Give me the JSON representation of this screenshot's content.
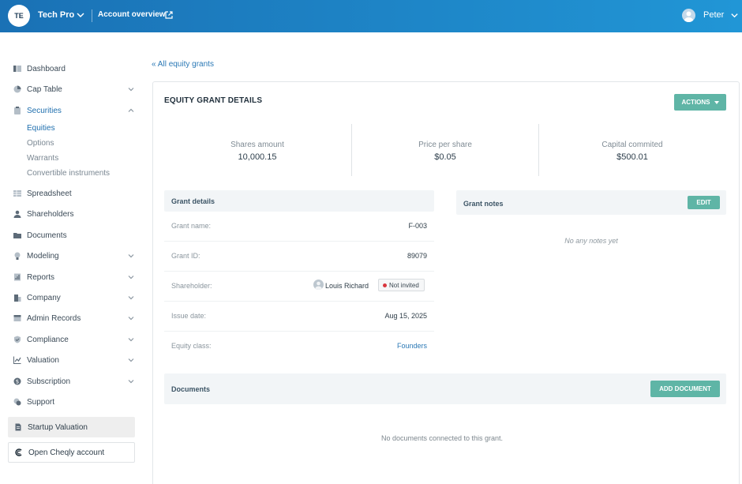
{
  "header": {
    "org_initials": "TE",
    "org_name": "Tech Pro",
    "account_link": "Account overview",
    "user_name": "Peter"
  },
  "sidebar": {
    "items": [
      {
        "label": "Dashboard",
        "icon": "dashboard-icon"
      },
      {
        "label": "Cap Table",
        "icon": "pie-chart-icon",
        "expandable": true
      },
      {
        "label": "Securities",
        "icon": "clipboard-icon",
        "expandable": true,
        "expanded": true,
        "active": true
      },
      {
        "label": "Spreadsheet",
        "icon": "grid-icon"
      },
      {
        "label": "Shareholders",
        "icon": "person-icon"
      },
      {
        "label": "Documents",
        "icon": "folder-icon"
      },
      {
        "label": "Modeling",
        "icon": "bulb-icon",
        "expandable": true
      },
      {
        "label": "Reports",
        "icon": "report-icon",
        "expandable": true
      },
      {
        "label": "Company",
        "icon": "building-icon",
        "expandable": true
      },
      {
        "label": "Admin Records",
        "icon": "records-icon",
        "expandable": true
      },
      {
        "label": "Compliance",
        "icon": "shield-icon",
        "expandable": true
      },
      {
        "label": "Valuation",
        "icon": "chart-icon",
        "expandable": true
      },
      {
        "label": "Subscription",
        "icon": "coin-icon",
        "expandable": true
      },
      {
        "label": "Support",
        "icon": "support-icon"
      }
    ],
    "sub_items": [
      "Equities",
      "Options",
      "Warrants",
      "Convertible instruments"
    ],
    "active_sub": "Equities",
    "startup_valuation": "Startup Valuation",
    "open_cheqly": "Open Cheqly account"
  },
  "main": {
    "back_link": "All equity grants",
    "title": "EQUITY GRANT DETAILS",
    "actions_label": "ACTIONS",
    "stats": [
      {
        "label": "Shares amount",
        "value": "10,000.15"
      },
      {
        "label": "Price per share",
        "value": "$0.05"
      },
      {
        "label": "Capital commited",
        "value": "$500.01"
      }
    ],
    "grant_details": {
      "title": "Grant details",
      "rows": [
        {
          "key": "Grant name:",
          "value": "F-003"
        },
        {
          "key": "Grant ID:",
          "value": "89079"
        },
        {
          "key": "Shareholder:",
          "value": "Louis Richard",
          "badge": "Not invited"
        },
        {
          "key": "Issue date:",
          "value": "Aug 15, 2025"
        },
        {
          "key": "Equity class:",
          "value": "Founders"
        }
      ]
    },
    "grant_notes": {
      "title": "Grant notes",
      "edit_label": "EDIT",
      "empty": "No any notes yet"
    },
    "documents": {
      "title": "Documents",
      "add_label": "ADD DOCUMENT",
      "empty": "No documents connected to this grant."
    }
  },
  "colors": {
    "header_start": "#1a71b5",
    "header_end": "#2196d6",
    "accent_button": "#5fb5a6",
    "link": "#2a78b5",
    "status_dot": "#d9363e"
  }
}
